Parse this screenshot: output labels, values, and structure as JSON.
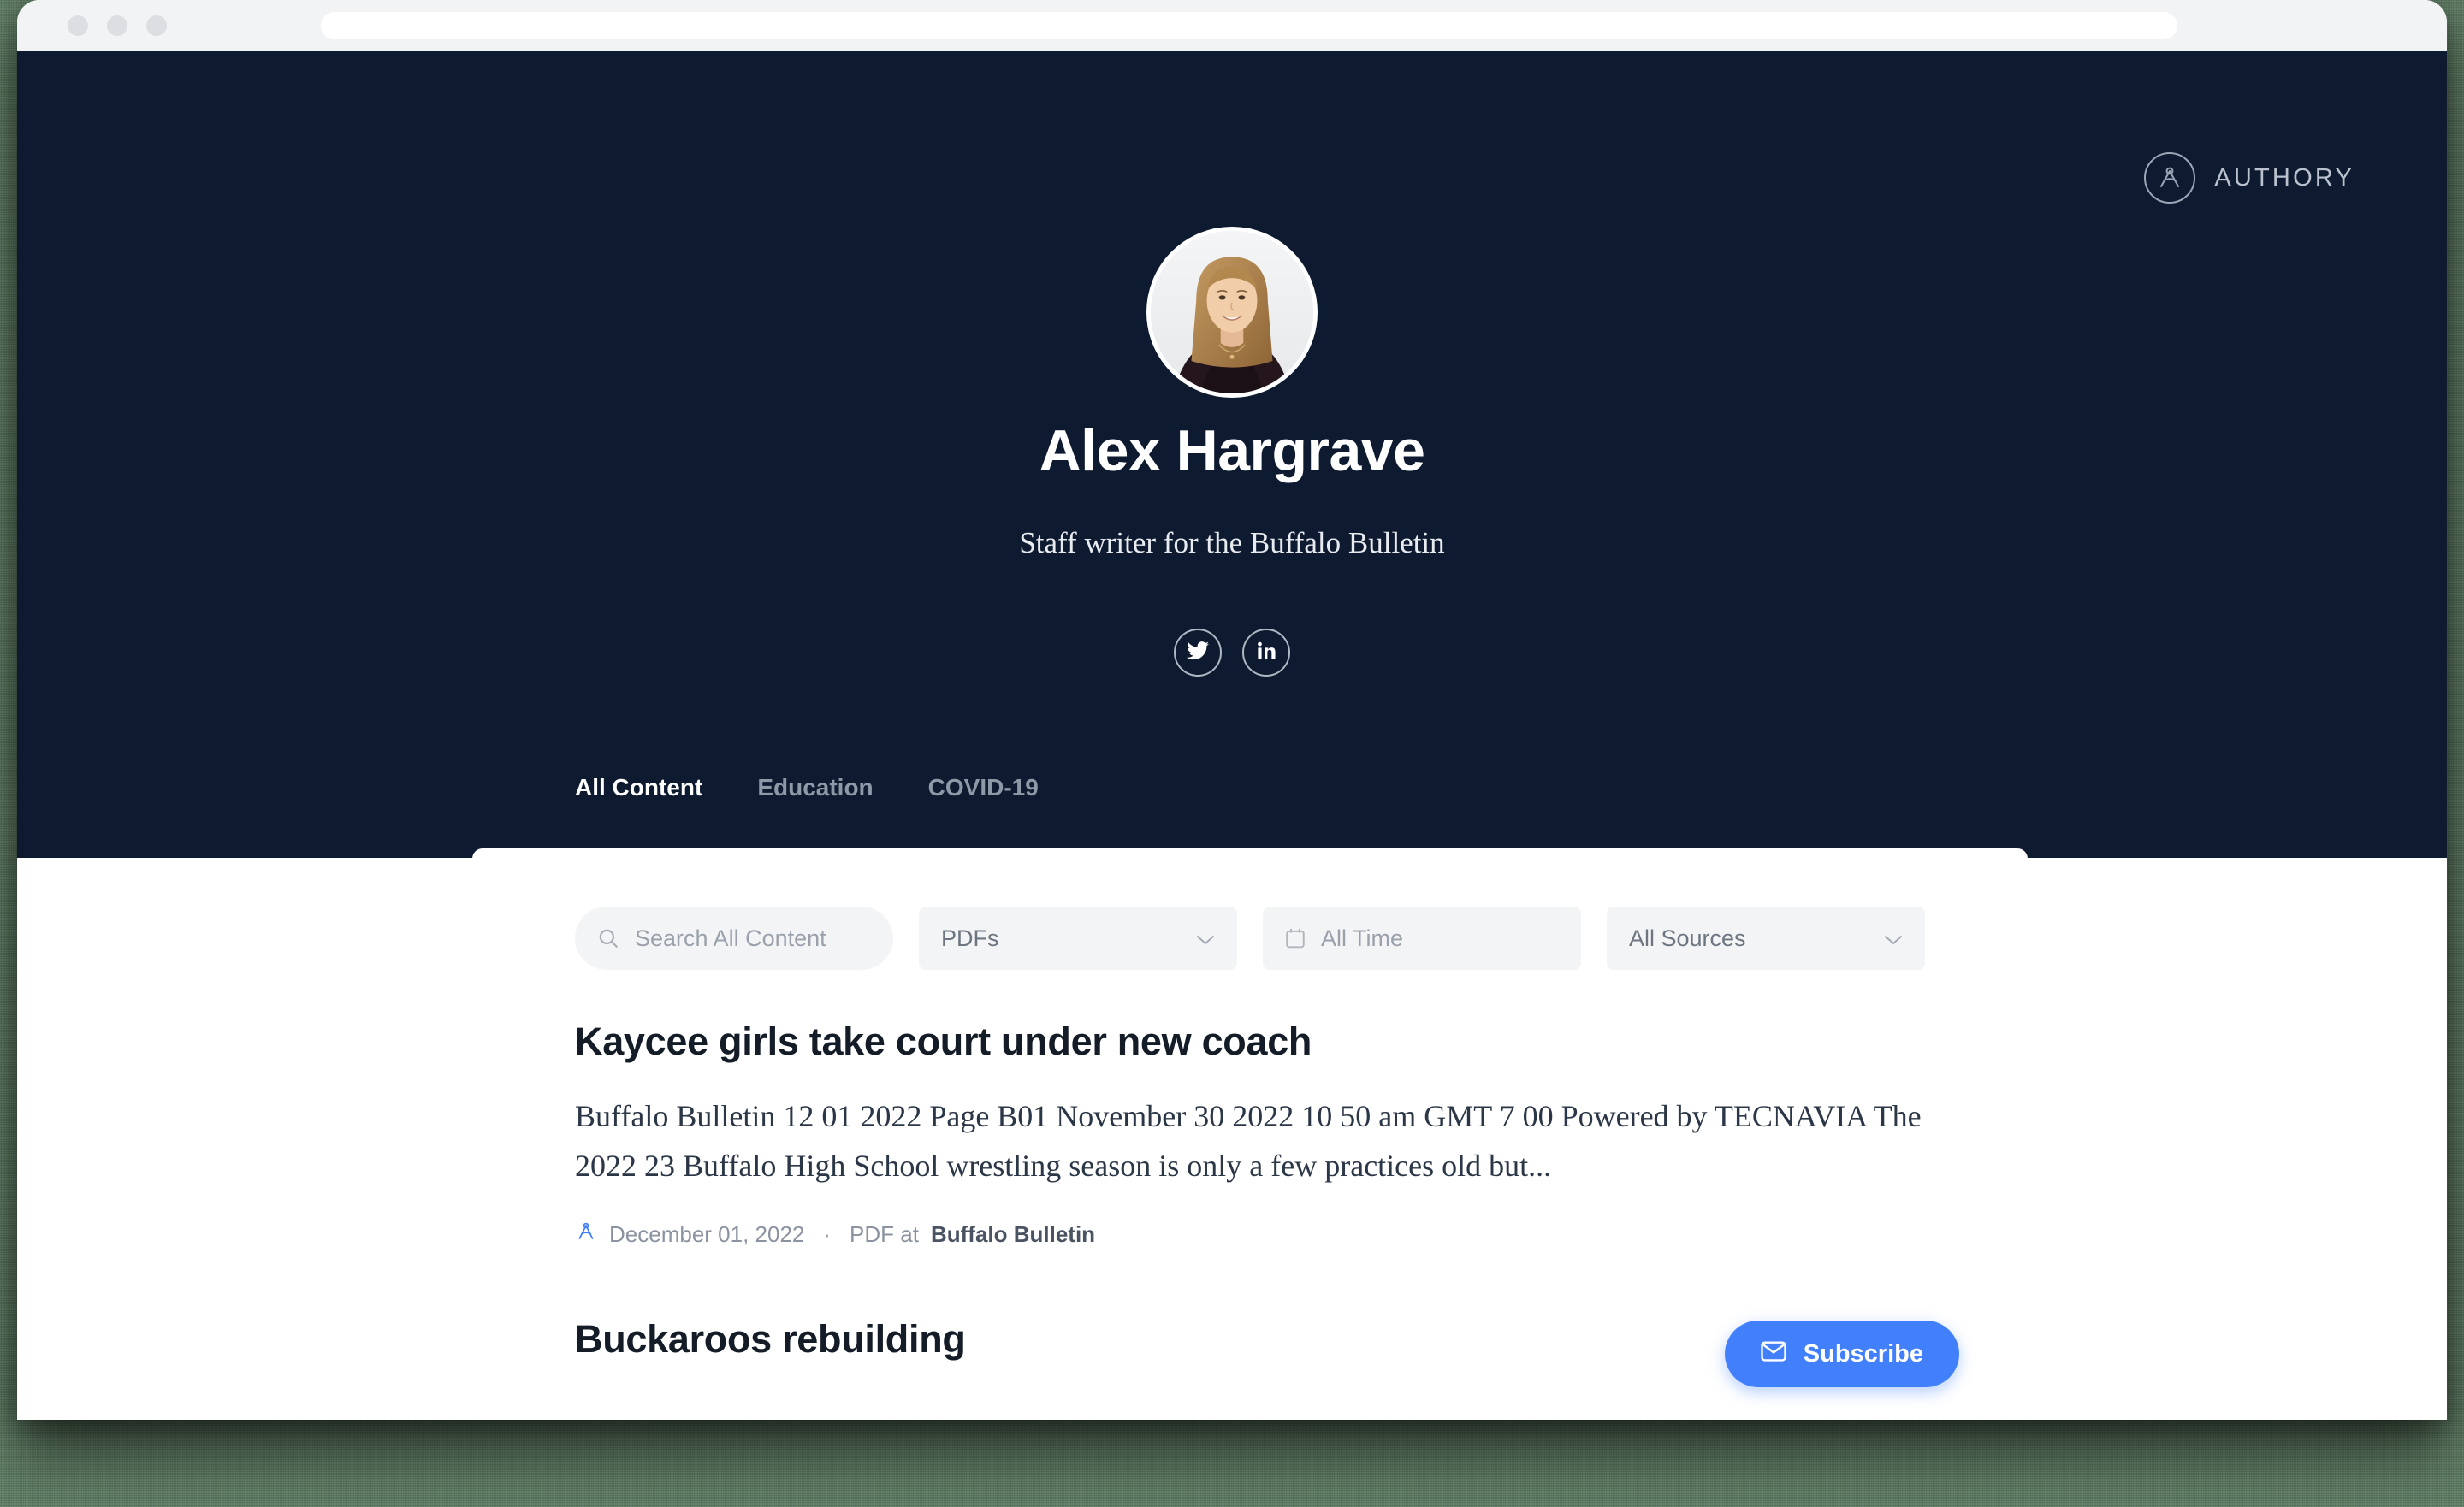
{
  "browser": {
    "url_value": "",
    "url_placeholder": ""
  },
  "brand": {
    "logo_text": "AUTHORY",
    "logo_icon": "authory-compass-icon"
  },
  "profile": {
    "name": "Alex Hargrave",
    "tagline": "Staff writer for the Buffalo Bulletin",
    "avatar_icon": "profile-photo",
    "social": [
      {
        "id": "twitter",
        "icon": "twitter-icon",
        "label": "Twitter"
      },
      {
        "id": "linkedin",
        "icon": "linkedin-icon",
        "label": "LinkedIn"
      }
    ]
  },
  "tabs": [
    {
      "label": "All Content",
      "active": true
    },
    {
      "label": "Education",
      "active": false
    },
    {
      "label": "COVID-19",
      "active": false
    }
  ],
  "filters": {
    "search": {
      "icon": "search-icon",
      "value": "",
      "placeholder": "Search All Content"
    },
    "type": {
      "value": "PDFs",
      "icon": "chevron-down-icon"
    },
    "time": {
      "value": "All Time",
      "icon": "calendar-icon"
    },
    "source": {
      "value": "All Sources",
      "icon": "chevron-down-icon"
    }
  },
  "articles": [
    {
      "title": "Kaycee girls take court under new coach",
      "description": "Buffalo Bulletin 12 01 2022 Page B01 November 30 2022 10 50 am GMT 7 00 Powered by TECNAVIA The 2022 23 Buffalo High School wrestling season is only a few practices old but...",
      "meta": {
        "icon": "authory-a-icon",
        "date": "December 01, 2022",
        "separator": "·",
        "type": "PDF at",
        "source": "Buffalo Bulletin"
      }
    },
    {
      "title": "Buckaroos rebuilding",
      "description": "",
      "meta": null
    }
  ],
  "subscribe": {
    "label": "Subscribe",
    "icon": "envelope-icon"
  },
  "colors": {
    "hero_navy": "#0e1a2f",
    "accent_blue": "#3d71f7",
    "subscribe_blue": "#4280fb",
    "backdrop_green": "#5e7d63",
    "filter_grey": "#f3f4f6"
  }
}
